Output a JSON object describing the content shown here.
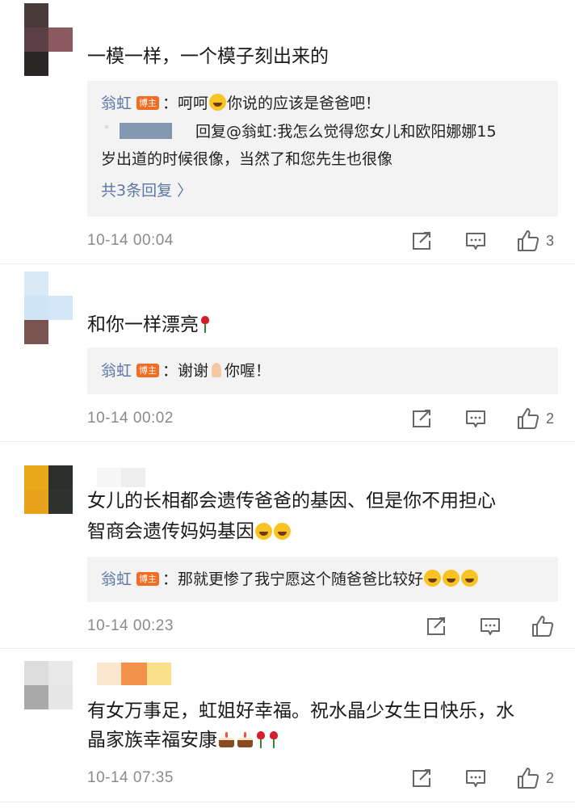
{
  "comments": [
    {
      "text": "一模一样，一个模子刻出来的",
      "reply": {
        "author": "翁虹",
        "badge": "博主",
        "text_before_emoji": "：呵呵",
        "text_after_emoji": "你说的应该是爸爸吧！"
      },
      "subreply": {
        "line1": "回复@翁虹:我怎么觉得您女儿和欧阳娜娜15",
        "line2": "岁出道的时候很像，当然了和您先生也很像"
      },
      "more": "共3条回复 〉",
      "time": "10-14 00:04",
      "likes": "3"
    },
    {
      "text": "和你一样漂亮",
      "reply": {
        "author": "翁虹",
        "badge": "博主",
        "text_before_emoji": "：谢谢",
        "text_after_emoji": "你喔！"
      },
      "time": "10-14 00:02",
      "likes": "2"
    },
    {
      "text_line1": "女儿的长相都会遗传爸爸的基因、但是你不用担心",
      "text_line2": "智商会遗传妈妈基因",
      "reply": {
        "author": "翁虹",
        "badge": "博主",
        "text": "：那就更惨了我宁愿这个随爸爸比较好"
      },
      "time": "10-14 00:23",
      "likes": ""
    },
    {
      "text_line1": "有女万事足，虹姐好幸福。祝水晶少女生日快乐，水",
      "text_line2": "晶家族幸福安康",
      "time": "10-14 07:35",
      "likes": "2"
    }
  ],
  "icons": {
    "share": "share-icon",
    "comment": "comment-icon",
    "like": "thumbs-up-icon"
  },
  "colors": {
    "author": "#5b77a6",
    "badge": "#f26d23",
    "reply_bg": "#f3f3f3",
    "meta": "#8a8a8a"
  }
}
